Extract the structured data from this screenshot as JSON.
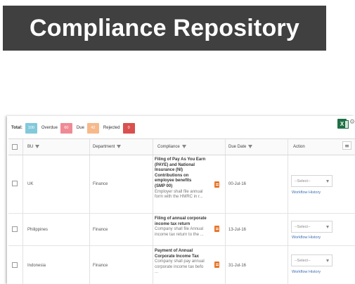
{
  "banner": {
    "title": "Compliance Repository"
  },
  "summary": {
    "total_label": "Total:",
    "total_count": "100",
    "overdue_label": "Overdue",
    "overdue_count": "60",
    "due_label": "Due",
    "due_count": "42",
    "rejected_label": "Rejected",
    "rejected_count": "0"
  },
  "colors": {
    "banner_bg": "#404040",
    "total_badge": "#82c9da",
    "overdue_badge": "#ef8a95",
    "due_badge": "#f6b98b",
    "rejected_badge": "#d9504e",
    "doc_icon": "#e8762b",
    "link": "#3f6fb5",
    "excel": "#1e7145"
  },
  "toolbar": {
    "excel_icon": "excel-export-icon",
    "excel_letter": "X",
    "settings_icon": "gear-icon",
    "settings_glyph": "⚙"
  },
  "table": {
    "columns": {
      "bu": "BU",
      "department": "Department",
      "compliance": "Compliance",
      "due_date": "Due Date",
      "action": "Action",
      "menu_glyph": "≡"
    },
    "rows": [
      {
        "bu": "UK",
        "department": "Finance",
        "title_lines": [
          "Filing of Pay As You Earn",
          "(PAYE) and National",
          "Insurance (NI)",
          "Contributions on",
          "employee benefits",
          "(SMP 00)"
        ],
        "desc_lines": [
          "Employer shall file annual",
          "form with the HMRC in r..."
        ],
        "due_date": "00-Jul-16",
        "action_placeholder": "--Select--",
        "workflow_link": "Workflow History"
      },
      {
        "bu": "Philippines",
        "department": "Finance",
        "title_lines": [
          "Filing of annual corporate",
          "income tax return"
        ],
        "desc_lines": [
          "Company shall file Annual",
          "income tax return to the ..."
        ],
        "due_date": "13-Jul-16",
        "action_placeholder": "--Select--",
        "workflow_link": "Workflow History"
      },
      {
        "bu": "Indonesia",
        "department": "Finance",
        "title_lines": [
          "Payment of Annual",
          "Corporate Income Tax"
        ],
        "desc_lines": [
          "Company shall pay annual",
          "corporate income tax befo",
          "..."
        ],
        "due_date": "31-Jul-16",
        "action_placeholder": "--Select--",
        "workflow_link": "Workflow History"
      }
    ]
  }
}
